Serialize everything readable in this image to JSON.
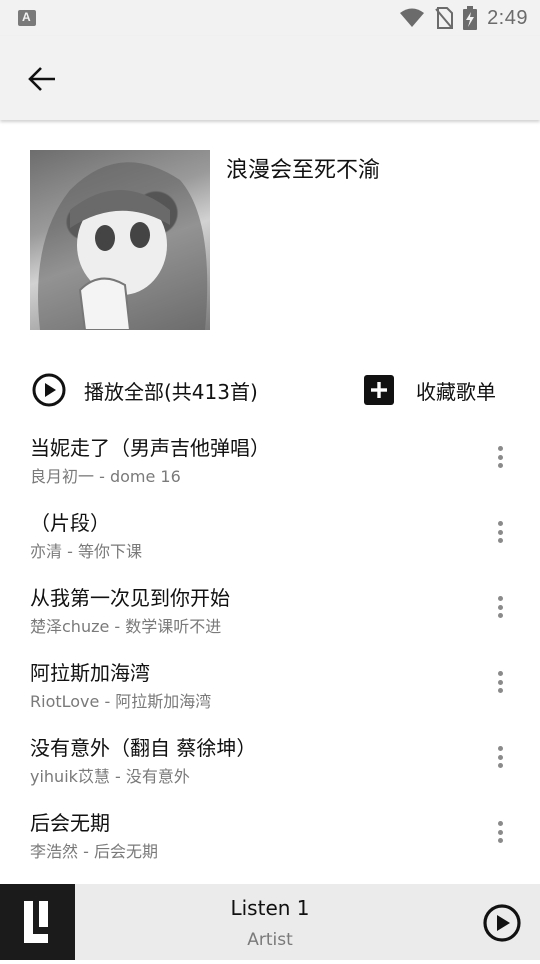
{
  "status_bar": {
    "left_badge": "A",
    "time": "2:49"
  },
  "playlist": {
    "title": "浪漫会至死不渝"
  },
  "actions": {
    "play_all_label": "播放全部(共413首)",
    "collect_label": "收藏歌单"
  },
  "songs": [
    {
      "title": "当妮走了（男声吉他弹唱）",
      "subtitle": "良月初一 - dome 16"
    },
    {
      "title": "（片段）",
      "subtitle": "亦清 - 等你下课"
    },
    {
      "title": "从我第一次见到你开始",
      "subtitle": "楚泽chuze - 数学课听不进"
    },
    {
      "title": "阿拉斯加海湾",
      "subtitle": "RiotLove - 阿拉斯加海湾"
    },
    {
      "title": "没有意外（翻自 蔡徐坤）",
      "subtitle": "yihuik苡慧 - 没有意外"
    },
    {
      "title": "后会无期",
      "subtitle": "李浩然 - 后会无期"
    }
  ],
  "mini_player": {
    "title": "Listen 1",
    "artist": "Artist"
  },
  "icons": {
    "back": "arrow-left-icon",
    "play_all": "play-circle-icon",
    "collect": "add-box-icon",
    "more": "more-vert-icon",
    "mini_play": "play-circle-icon",
    "logo": "listen1-logo-icon"
  },
  "colors": {
    "app_bar": "#f2f2f2",
    "text_primary": "#111111",
    "text_secondary": "#7a7a7a",
    "mini_player_bg": "#ebebeb",
    "logo_bg": "#1b1b1b"
  }
}
